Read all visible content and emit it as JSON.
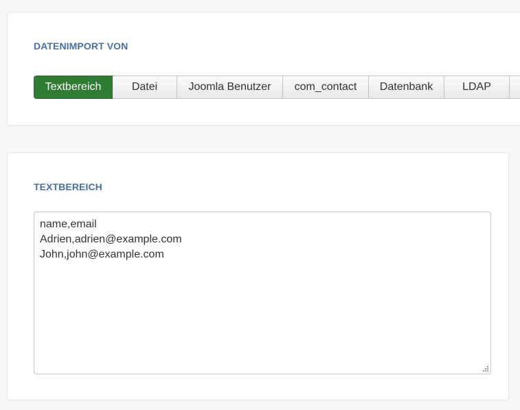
{
  "import_section": {
    "title": "DATENIMPORT VON",
    "tabs": [
      {
        "label": "Textbereich",
        "active": true
      },
      {
        "label": "Datei",
        "active": false
      },
      {
        "label": "Joomla Benutzer",
        "active": false
      },
      {
        "label": "com_contact",
        "active": false
      },
      {
        "label": "Datenbank",
        "active": false
      },
      {
        "label": "LDAP",
        "active": false
      },
      {
        "label": "",
        "active": false
      }
    ]
  },
  "textarea_section": {
    "title": "TEXTBEREICH",
    "value": "name,email\nAdrien,adrien@example.com\nJohn,john@example.com"
  },
  "colors": {
    "accent_title": "#4a6fa5",
    "active_tab": "#2f7d32",
    "background": "#f7f7f7"
  }
}
